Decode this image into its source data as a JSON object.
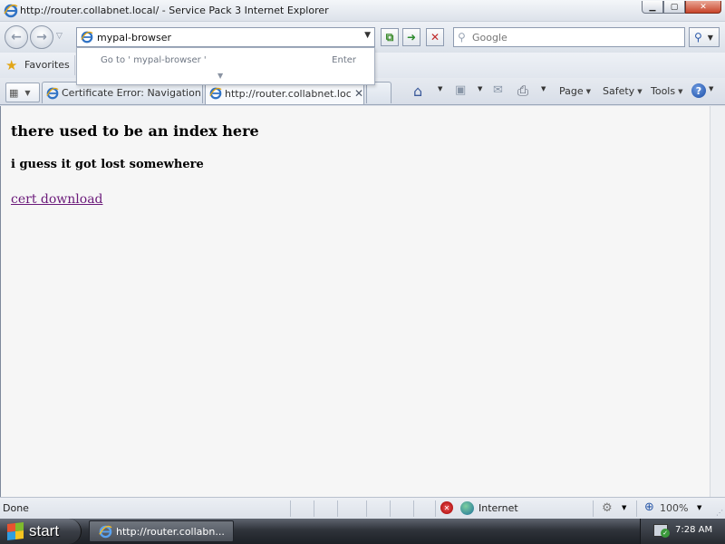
{
  "window": {
    "title": "http://router.collabnet.local/ - Service Pack 3 Internet Explorer"
  },
  "navbar": {
    "address_value": "mypal-browser",
    "search_placeholder": "Google",
    "autocomplete": {
      "goto_text": "Go to ' mypal-browser '",
      "enter_hint": "Enter"
    }
  },
  "favorites": {
    "label": "Favorites"
  },
  "tabs": [
    {
      "label": "Certificate Error: Navigation B...",
      "active": false
    },
    {
      "label": "http://router.collabnet.loca...",
      "active": true
    }
  ],
  "command_bar": {
    "page_label": "Page",
    "safety_label": "Safety",
    "tools_label": "Tools",
    "help_glyph": "?"
  },
  "content": {
    "heading": "there used to be an index here",
    "subheading": "i guess it got lost somewhere",
    "link_text": "cert download"
  },
  "statusbar": {
    "status_text": "Done",
    "zone_label": "Internet",
    "zoom_label": "100%"
  },
  "taskbar": {
    "start_label": "start",
    "task_item_label": "http://router.collabn...",
    "clock": "7:28 AM"
  },
  "colors": {
    "link_visited": "#6b1a7a",
    "content_bg": "#f6f6f6",
    "taskbar": "#2f333a"
  },
  "icons": [
    "ie-logo-icon",
    "back-arrow-icon",
    "forward-arrow-icon",
    "go-arrow-icon",
    "stop-icon",
    "search-icon",
    "favorites-star-icon",
    "quick-tabs-icon",
    "home-icon",
    "feeds-icon",
    "mail-icon",
    "print-icon",
    "help-icon",
    "security-error-icon",
    "internet-zone-icon",
    "protected-mode-icon",
    "zoom-icon",
    "windows-logo-icon",
    "network-tray-icon"
  ]
}
